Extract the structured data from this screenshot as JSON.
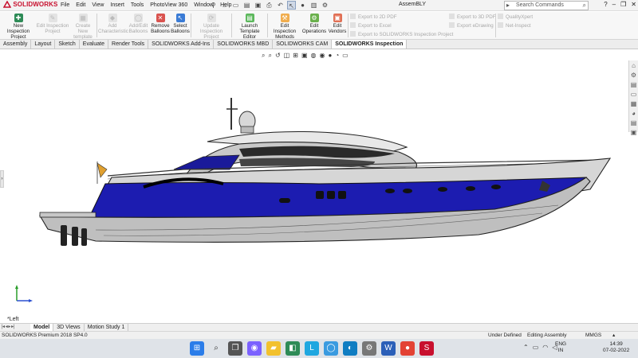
{
  "app": {
    "logo_text": "SOLIDWORKS",
    "document_title": "AssemBLY",
    "brand_color": "#c8102e"
  },
  "menu": [
    "File",
    "Edit",
    "View",
    "Insert",
    "Tools",
    "PhotoView 360",
    "Window",
    "Help"
  ],
  "search": {
    "placeholder": "Search Commands"
  },
  "ribbon": {
    "buttons": [
      {
        "label": [
          "New Inspection",
          "Project"
        ],
        "enabled": true
      },
      {
        "label": [
          "Edit Inspection",
          "Project"
        ],
        "enabled": false
      },
      {
        "label": [
          "Create New",
          "template"
        ],
        "enabled": false
      },
      {
        "label": [
          "Add",
          "Characteristic"
        ],
        "enabled": false
      },
      {
        "label": [
          "Add/Edit",
          "Balloons"
        ],
        "enabled": false
      },
      {
        "label": [
          "Remove",
          "Balloons"
        ],
        "enabled": true
      },
      {
        "label": [
          "Select",
          "Balloons"
        ],
        "enabled": true
      },
      {
        "label": [
          "Update Inspection",
          "Project"
        ],
        "enabled": false
      },
      {
        "label": [
          "Launch",
          "Template Editor"
        ],
        "enabled": true
      },
      {
        "label": [
          "Edit Inspection",
          "Methods"
        ],
        "enabled": true
      },
      {
        "label": [
          "Edit",
          "Operations"
        ],
        "enabled": true
      },
      {
        "label": [
          "Edit",
          "Vendors"
        ],
        "enabled": true
      }
    ],
    "export_items": [
      "Export to 2D PDF",
      "Export to Excel",
      "Export to SOLIDWORKS Inspection Project"
    ],
    "export3d_items": [
      "Export to 3D PDF",
      "Export eDrawing"
    ],
    "extra_items": [
      "QualityXpert",
      "Net-Inspect"
    ]
  },
  "tabs": [
    "Assembly",
    "Layout",
    "Sketch",
    "Evaluate",
    "Render Tools",
    "SOLIDWORKS Add-Ins",
    "SOLIDWORKS MBD",
    "SOLIDWORKS CAM",
    "SOLIDWORKS Inspection"
  ],
  "active_tab": "SOLIDWORKS Inspection",
  "viewport": {
    "view_name": "*Left"
  },
  "bottom_tabs": [
    "Model",
    "3D Views",
    "Motion Study 1"
  ],
  "active_bottom_tab": "Model",
  "status": {
    "version": "SOLIDWORKS Premium 2018 SP4.0",
    "state": "Under Defined",
    "mode": "Editing Assembly",
    "units": "MMGS"
  },
  "taskbar": {
    "lang": [
      "ENG",
      "IN"
    ],
    "time": "14:39",
    "date": "07-02-2022"
  }
}
